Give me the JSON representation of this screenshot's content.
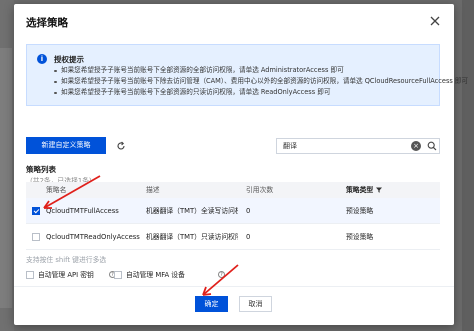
{
  "dialog": {
    "title": "选择策略",
    "notice": {
      "heading": "授权提示",
      "items": [
        "如果您希望授予子账号当前账号下全部资源的全部访问权限，请单选 AdministratorAccess 即可",
        "如果您希望授予子账号当前账号下除去访问管理（CAM）、费用中心以外的全部资源的访问权限，请单选 QCloudResourceFullAccess 即可",
        "如果您希望授予子账号当前账号下全部资源的只读访问权限，请单选 ReadOnlyAccess 即可"
      ]
    },
    "new_policy_button": "新建自定义策略",
    "search": {
      "value": "翻译",
      "placeholder": ""
    },
    "list": {
      "label": "策略列表",
      "count": "（共2条，已选择1条）",
      "headers": {
        "name": "策略名",
        "desc": "描述",
        "refs": "引用次数",
        "type": "策略类型"
      },
      "rows": [
        {
          "name": "QcloudTMTFullAccess",
          "desc": "机器翻译（TMT）全读写访问权限",
          "refs": "0",
          "type": "预设策略",
          "checked": true
        },
        {
          "name": "QcloudTMTReadOnlyAccess",
          "desc": "机器翻译（TMT）只读访问权限",
          "refs": "0",
          "type": "预设策略",
          "checked": false
        }
      ]
    },
    "shift_hint": "支持按住 shift 键进行多选",
    "options": {
      "api_key": "自动管理 API 密钥",
      "mfa": "自动管理 MFA 设备"
    },
    "ok_button": "确定",
    "cancel_button": "取消"
  },
  "colors": {
    "accent": "#0052d9",
    "annotation_arrow": "#e0201b"
  }
}
